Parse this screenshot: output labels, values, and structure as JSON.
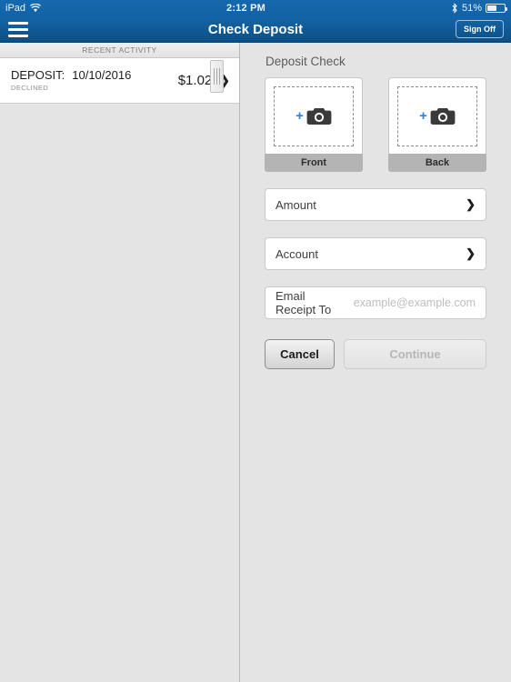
{
  "statusbar": {
    "device": "iPad",
    "wifi_icon": "wifi-icon",
    "time": "2:12 PM",
    "bluetooth_icon": "bluetooth-icon",
    "battery_percent": "51%",
    "battery_icon": "battery-icon"
  },
  "navbar": {
    "menu_icon": "hamburger-menu-icon",
    "title": "Check Deposit",
    "signoff_label": "Sign Off"
  },
  "sidebar": {
    "header": "RECENT ACTIVITY",
    "activity": {
      "label": "DEPOSIT:",
      "date": "10/10/2016",
      "status": "DECLINED",
      "amount": "$1.02",
      "chevron_icon": "chevron-right-icon"
    }
  },
  "main": {
    "section_title": "Deposit Check",
    "captures": [
      {
        "name": "front",
        "label": "Front",
        "add_icon": "plus-icon",
        "camera_icon": "camera-icon"
      },
      {
        "name": "back",
        "label": "Back",
        "add_icon": "plus-icon",
        "camera_icon": "camera-icon"
      }
    ],
    "fields": [
      {
        "label": "Amount",
        "chevron_icon": "chevron-right-icon"
      },
      {
        "label": "Account",
        "chevron_icon": "chevron-right-icon"
      }
    ],
    "email": {
      "label": "Email Receipt To",
      "value": "",
      "placeholder": "example@example.com"
    },
    "buttons": {
      "cancel": "Cancel",
      "continue": "Continue"
    },
    "drag_handle_icon": "drag-handle-icon"
  },
  "colors": {
    "brand_blue": "#1565a8",
    "accent_blue": "#2f80d6",
    "page_bg": "#e4e4e4",
    "label_gray": "#b4b4b4"
  }
}
